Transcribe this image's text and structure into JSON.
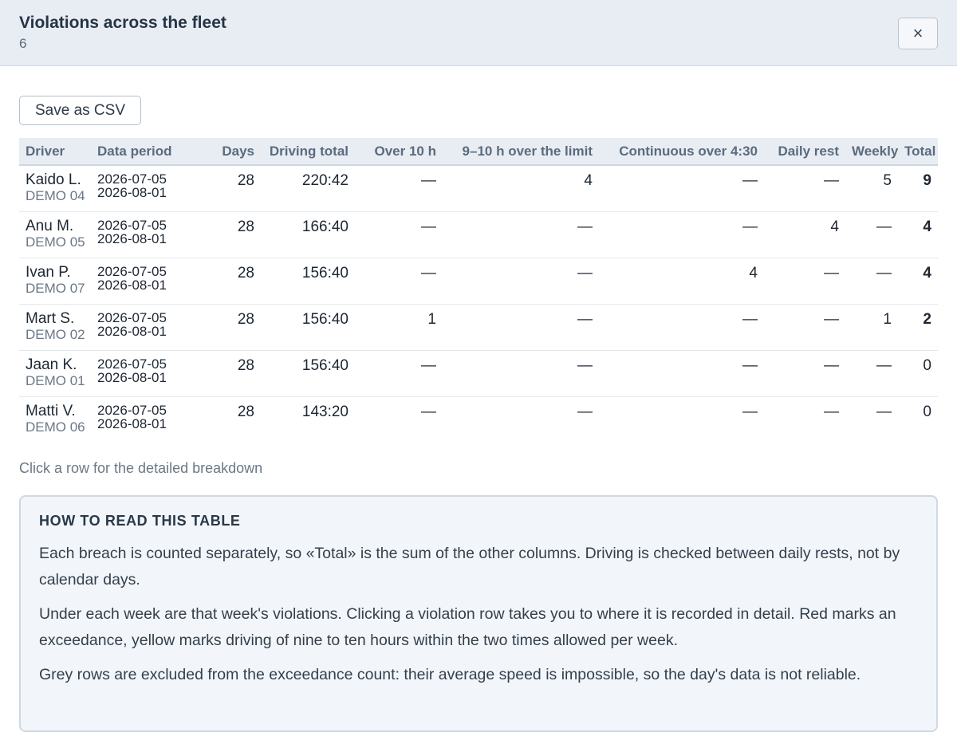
{
  "header": {
    "title": "Violations across the fleet",
    "subtitle": "6",
    "close_label": "×"
  },
  "toolbar": {
    "csv_label": "Save as CSV"
  },
  "table": {
    "columns": [
      "Driver",
      "Data period",
      "Days",
      "Driving total",
      "Over 10 h",
      "9–10 h over the limit",
      "Continuous over 4:30",
      "Daily rest",
      "Weekly",
      "Total"
    ],
    "rows": [
      {
        "name": "Kaido L.",
        "code": "DEMO 04",
        "from": "2026-07-05",
        "to": "2026-08-01",
        "days": "28",
        "driving": "220:42",
        "over10": "—",
        "h910": "4",
        "continuous": "—",
        "daily": "—",
        "weekly": "5",
        "total": "9"
      },
      {
        "name": "Anu M.",
        "code": "DEMO 05",
        "from": "2026-07-05",
        "to": "2026-08-01",
        "days": "28",
        "driving": "166:40",
        "over10": "—",
        "h910": "—",
        "continuous": "—",
        "daily": "4",
        "weekly": "—",
        "total": "4"
      },
      {
        "name": "Ivan P.",
        "code": "DEMO 07",
        "from": "2026-07-05",
        "to": "2026-08-01",
        "days": "28",
        "driving": "156:40",
        "over10": "—",
        "h910": "—",
        "continuous": "4",
        "daily": "—",
        "weekly": "—",
        "total": "4"
      },
      {
        "name": "Mart S.",
        "code": "DEMO 02",
        "from": "2026-07-05",
        "to": "2026-08-01",
        "days": "28",
        "driving": "156:40",
        "over10": "1",
        "h910": "—",
        "continuous": "—",
        "daily": "—",
        "weekly": "1",
        "total": "2"
      },
      {
        "name": "Jaan K.",
        "code": "DEMO 01",
        "from": "2026-07-05",
        "to": "2026-08-01",
        "days": "28",
        "driving": "156:40",
        "over10": "—",
        "h910": "—",
        "continuous": "—",
        "daily": "—",
        "weekly": "—",
        "total": "0"
      },
      {
        "name": "Matti V.",
        "code": "DEMO 06",
        "from": "2026-07-05",
        "to": "2026-08-01",
        "days": "28",
        "driving": "143:20",
        "over10": "—",
        "h910": "—",
        "continuous": "—",
        "daily": "—",
        "weekly": "—",
        "total": "0"
      }
    ]
  },
  "hint": "Click a row for the detailed breakdown",
  "info": {
    "title": "HOW TO READ THIS TABLE",
    "p1": "Each breach is counted separately, so «Total» is the sum of the other columns. Driving is checked between daily rests, not by calendar days.",
    "p2": "Under each week are that week's violations. Clicking a violation row takes you to where it is recorded in detail. Red marks an exceedance, yellow marks driving of nine to ten hours within the two times allowed per week.",
    "p3": "Grey rows are excluded from the exceedance count: their average speed is impossible, so the day's data is not reliable."
  },
  "colors": {
    "header_bg": "#e8edf3",
    "violation_red": "#a1292b",
    "total_red": "#8e1c1d",
    "total_green": "#3b6b31",
    "info_bg": "#f2f6fa"
  }
}
